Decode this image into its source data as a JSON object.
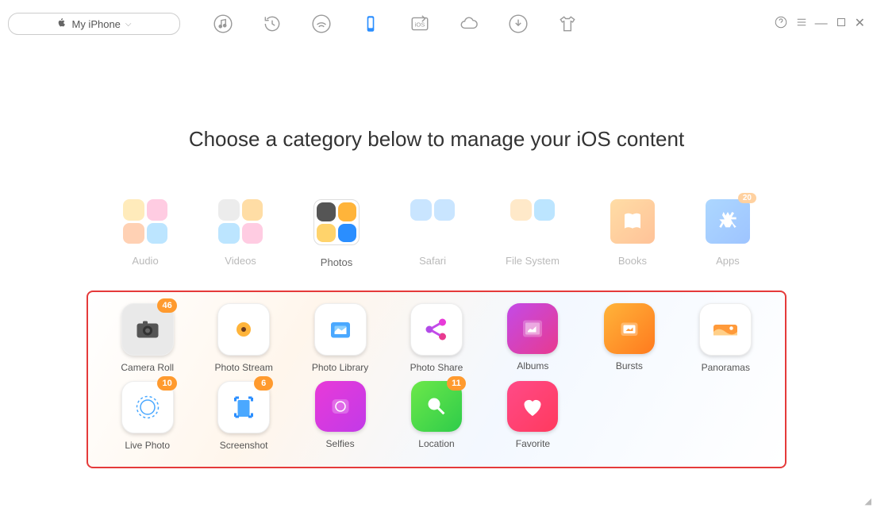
{
  "device": {
    "name": "My iPhone"
  },
  "headline": "Choose a category below to manage your iOS content",
  "toolbar_icons": [
    "music",
    "history",
    "wifi",
    "phone",
    "ios",
    "cloud",
    "download",
    "shirt"
  ],
  "categories": [
    {
      "key": "audio",
      "label": "Audio"
    },
    {
      "key": "videos",
      "label": "Videos"
    },
    {
      "key": "photos",
      "label": "Photos",
      "active": true
    },
    {
      "key": "safari",
      "label": "Safari"
    },
    {
      "key": "filesystem",
      "label": "File System"
    },
    {
      "key": "books",
      "label": "Books"
    },
    {
      "key": "apps",
      "label": "Apps",
      "badge": 20
    }
  ],
  "subitems": [
    {
      "key": "camera-roll",
      "label": "Camera Roll",
      "badge": 46,
      "bg": "#e9e9e9"
    },
    {
      "key": "photo-stream",
      "label": "Photo Stream",
      "bg": "#ffffff"
    },
    {
      "key": "photo-library",
      "label": "Photo Library",
      "bg": "#ffffff"
    },
    {
      "key": "photo-share",
      "label": "Photo Share",
      "bg": "#ffffff"
    },
    {
      "key": "albums",
      "label": "Albums",
      "bg": "linear-gradient(135deg,#c34ae8,#e83a8f)"
    },
    {
      "key": "bursts",
      "label": "Bursts",
      "bg": "linear-gradient(135deg,#ffb43a,#ff7a1e)"
    },
    {
      "key": "panoramas",
      "label": "Panoramas",
      "bg": "#ffffff"
    },
    {
      "key": "live-photo",
      "label": "Live Photo",
      "badge": 10,
      "bg": "#ffffff"
    },
    {
      "key": "screenshot",
      "label": "Screenshot",
      "badge": 6,
      "bg": "#ffffff"
    },
    {
      "key": "selfies",
      "label": "Selfies",
      "bg": "linear-gradient(135deg,#e83ad8,#c23ae8)"
    },
    {
      "key": "location",
      "label": "Location",
      "badge": 11,
      "bg": "linear-gradient(135deg,#6ce84a,#2ecc4a)"
    },
    {
      "key": "favorite",
      "label": "Favorite",
      "bg": "linear-gradient(135deg,#ff4a88,#ff3a5e)"
    }
  ],
  "colors": {
    "accent": "#2a8eff",
    "badge": "#ff9a2e",
    "panel_border": "#e53a3a"
  }
}
